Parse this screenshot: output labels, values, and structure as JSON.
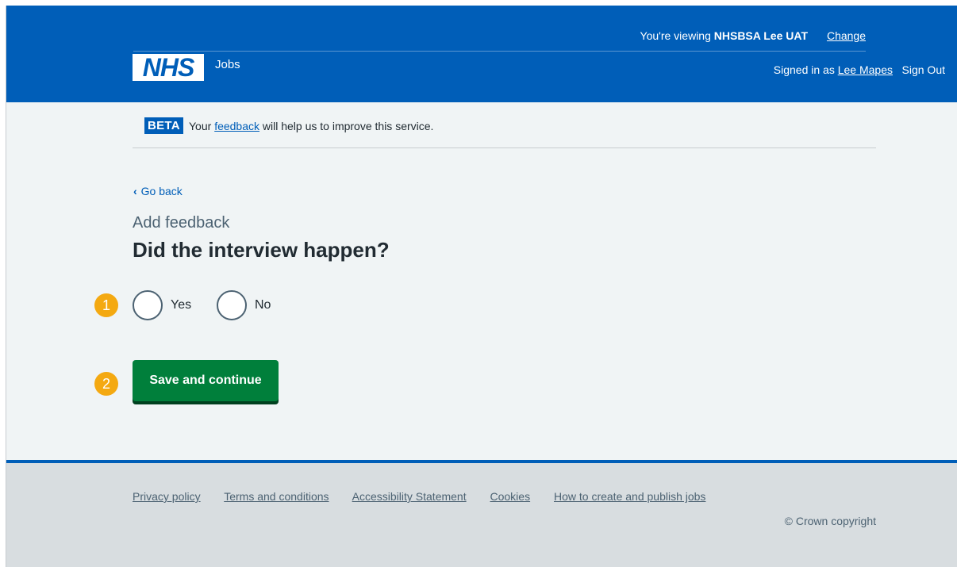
{
  "header": {
    "viewing_prefix": "You're viewing ",
    "viewing_org": "NHSBSA Lee UAT",
    "change_link": "Change",
    "logo_text": "NHS",
    "service_name": "Jobs",
    "signed_in_prefix": "Signed in as ",
    "user_name": "Lee Mapes",
    "sign_out": "Sign Out"
  },
  "beta": {
    "tag": "BETA",
    "text_before": "Your ",
    "link": "feedback",
    "text_after": " will help us to improve this service."
  },
  "main": {
    "back_label": "Go back",
    "caption": "Add feedback",
    "heading": "Did the interview happen?",
    "options": [
      {
        "label": "Yes",
        "selected": false
      },
      {
        "label": "No",
        "selected": false
      }
    ],
    "save_label": "Save and continue"
  },
  "annotations": {
    "step1": "1",
    "step2": "2",
    "color": "#f4a911"
  },
  "footer": {
    "links": [
      "Privacy policy",
      "Terms and conditions",
      "Accessibility Statement",
      "Cookies",
      "How to create and publish jobs"
    ],
    "copyright": "© Crown copyright"
  },
  "colors": {
    "header_blue": "#005eb8",
    "button_green": "#007f3b",
    "page_bg": "#f0f4f5",
    "footer_bg": "#d8dde0"
  }
}
